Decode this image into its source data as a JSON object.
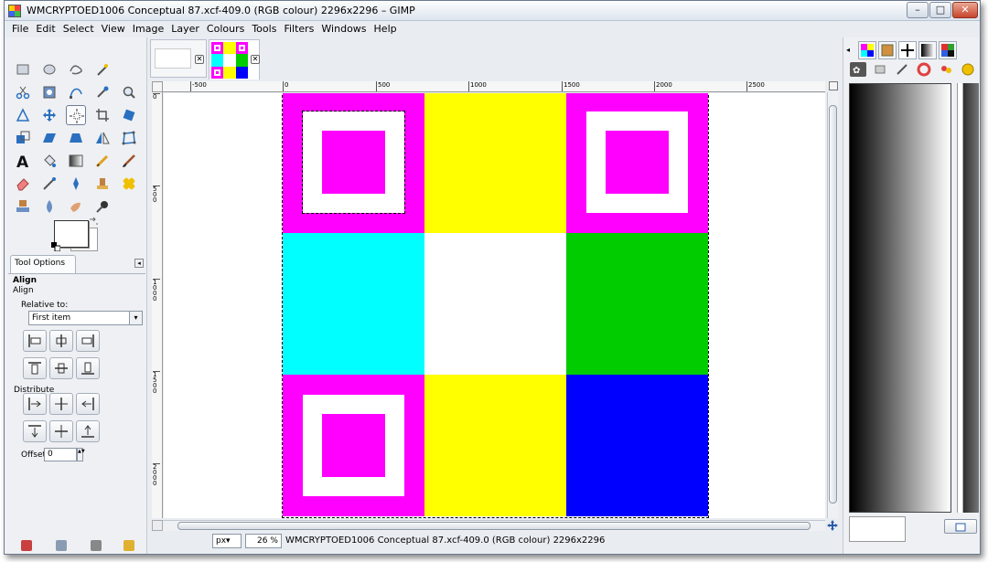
{
  "window": {
    "title": "WMCRYPTOED1006 Conceptual 87.xcf-409.0 (RGB colour) 2296x2296 – GIMP",
    "minimize": "–",
    "maximize": "□",
    "close": "✕"
  },
  "menu": [
    "File",
    "Edit",
    "Select",
    "View",
    "Image",
    "Layer",
    "Colours",
    "Tools",
    "Filters",
    "Windows",
    "Help"
  ],
  "tool_options": {
    "tab_label": "Tool Options",
    "menu_glyph": "◂",
    "title": "Align",
    "subtitle": "Align",
    "relative_to_label": "Relative to:",
    "relative_to_value": "First item",
    "relative_arrow": "▾",
    "distribute_label": "Distribute",
    "offset_label": "Offset:",
    "offset_value": "0",
    "offset_spin": "▲▼"
  },
  "image_tabs": {
    "close_glyph": "✕"
  },
  "rulers": {
    "horizontal": [
      "-500",
      "0",
      "500",
      "1000",
      "1500",
      "2000",
      "2500"
    ],
    "vertical": [
      "0",
      "500",
      "1000",
      "1500",
      "2000"
    ]
  },
  "statusbar": {
    "unit": "px",
    "unit_arrow": "▾",
    "zoom": "26 %",
    "text": "WMCRYPTOED1006 Conceptual 87.xcf-409.0 (RGB colour) 2296x2296"
  },
  "image_grid": {
    "colors": [
      [
        "#ff00ff",
        "#ffff00",
        "#ff00ff"
      ],
      [
        "#00ffff",
        "#ffffff",
        "#00cc00"
      ],
      [
        "#ff00ff",
        "#ffff00",
        "#0000ff"
      ]
    ],
    "nested_square_cells": [
      [
        0,
        0
      ],
      [
        0,
        2
      ],
      [
        2,
        0
      ]
    ]
  },
  "icons": {
    "toolbox": [
      "rect-select-icon",
      "ellipse-select-icon",
      "free-select-icon",
      "fuzzy-select-icon",
      "scissors-select-icon",
      "foreground-select-icon",
      "paths-icon",
      "color-picker-icon",
      "zoom-icon",
      "measure-icon",
      "move-icon",
      "align-icon",
      "crop-icon",
      "rotate-icon",
      "scale-icon",
      "shear-icon",
      "perspective-icon",
      "flip-icon",
      "cage-icon",
      "text-icon",
      "bucket-fill-icon",
      "blend-icon",
      "pencil-icon",
      "paintbrush-icon",
      "eraser-icon",
      "airbrush-icon",
      "ink-icon",
      "clone-icon",
      "heal-icon",
      "smudge-icon",
      "blur-icon",
      "dodge-burn-icon",
      "perspective-clone-icon"
    ]
  }
}
